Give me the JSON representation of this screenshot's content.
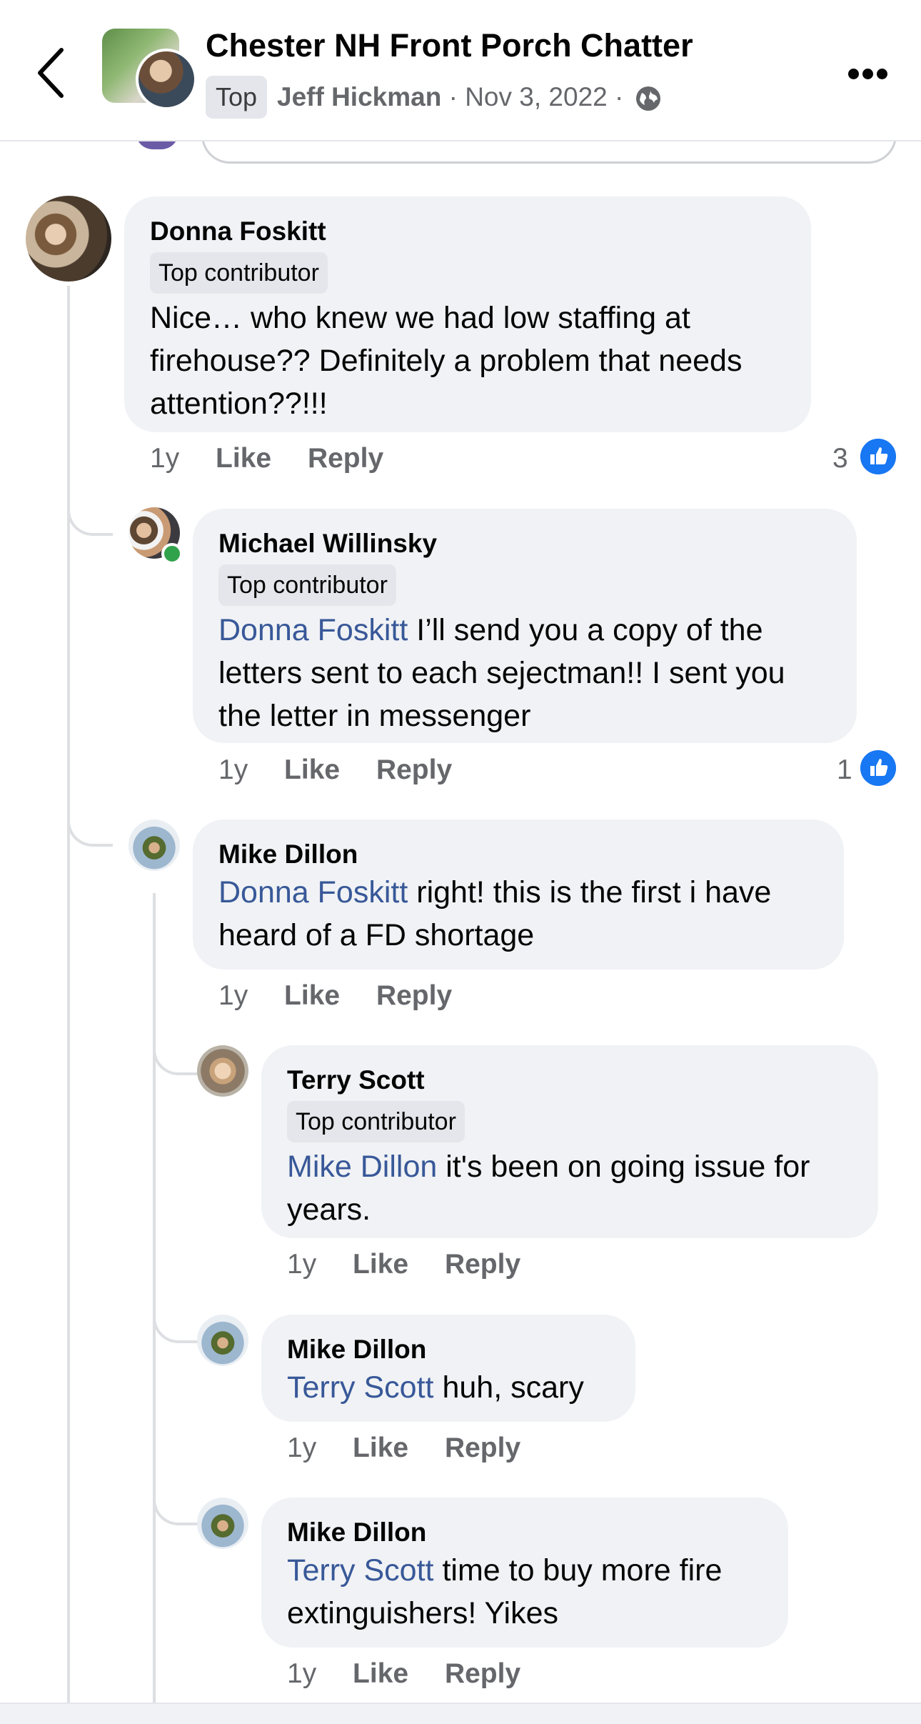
{
  "header": {
    "group_name": "Chester NH Front Porch Chatter",
    "badge": "Top",
    "author": "Jeff Hickman",
    "date_line": "· Nov 3, 2022 ·"
  },
  "comments": [
    {
      "name": "Donna Foskitt",
      "badge": "Top contributor",
      "mention": "",
      "text": "Nice… who knew we had low staffing at firehouse?? Definitely a problem that needs attention??!!!",
      "time": "1y",
      "like": "Like",
      "reply": "Reply",
      "reactions": "3"
    },
    {
      "name": "Michael Willinsky",
      "badge": "Top contributor",
      "mention": "Donna Foskitt",
      "text": " I’ll send you a copy of the letters sent to each sejectman!! I sent you the letter in messenger",
      "time": "1y",
      "like": "Like",
      "reply": "Reply",
      "reactions": "1"
    },
    {
      "name": "Mike Dillon",
      "badge": "",
      "mention": "Donna Foskitt",
      "text": " right! this is the first i have heard of a FD shortage",
      "time": "1y",
      "like": "Like",
      "reply": "Reply",
      "reactions": ""
    },
    {
      "name": "Terry Scott",
      "badge": "Top contributor",
      "mention": "Mike Dillon",
      "text": " it's been on going issue for years.",
      "time": "1y",
      "like": "Like",
      "reply": "Reply",
      "reactions": ""
    },
    {
      "name": "Mike Dillon",
      "badge": "",
      "mention": "Terry Scott",
      "text": " huh, scary",
      "time": "1y",
      "like": "Like",
      "reply": "Reply",
      "reactions": ""
    },
    {
      "name": "Mike Dillon",
      "badge": "",
      "mention": "Terry Scott",
      "text": " time to buy more fire extinguishers! Yikes",
      "time": "1y",
      "like": "Like",
      "reply": "Reply",
      "reactions": ""
    }
  ],
  "colors": {
    "link": "#385898",
    "bubble": "#f0f2f5",
    "like_blue": "#1877f2"
  },
  "icons": [
    "back-arrow-icon",
    "globe-icon",
    "more-icon",
    "like-reaction-icon"
  ]
}
